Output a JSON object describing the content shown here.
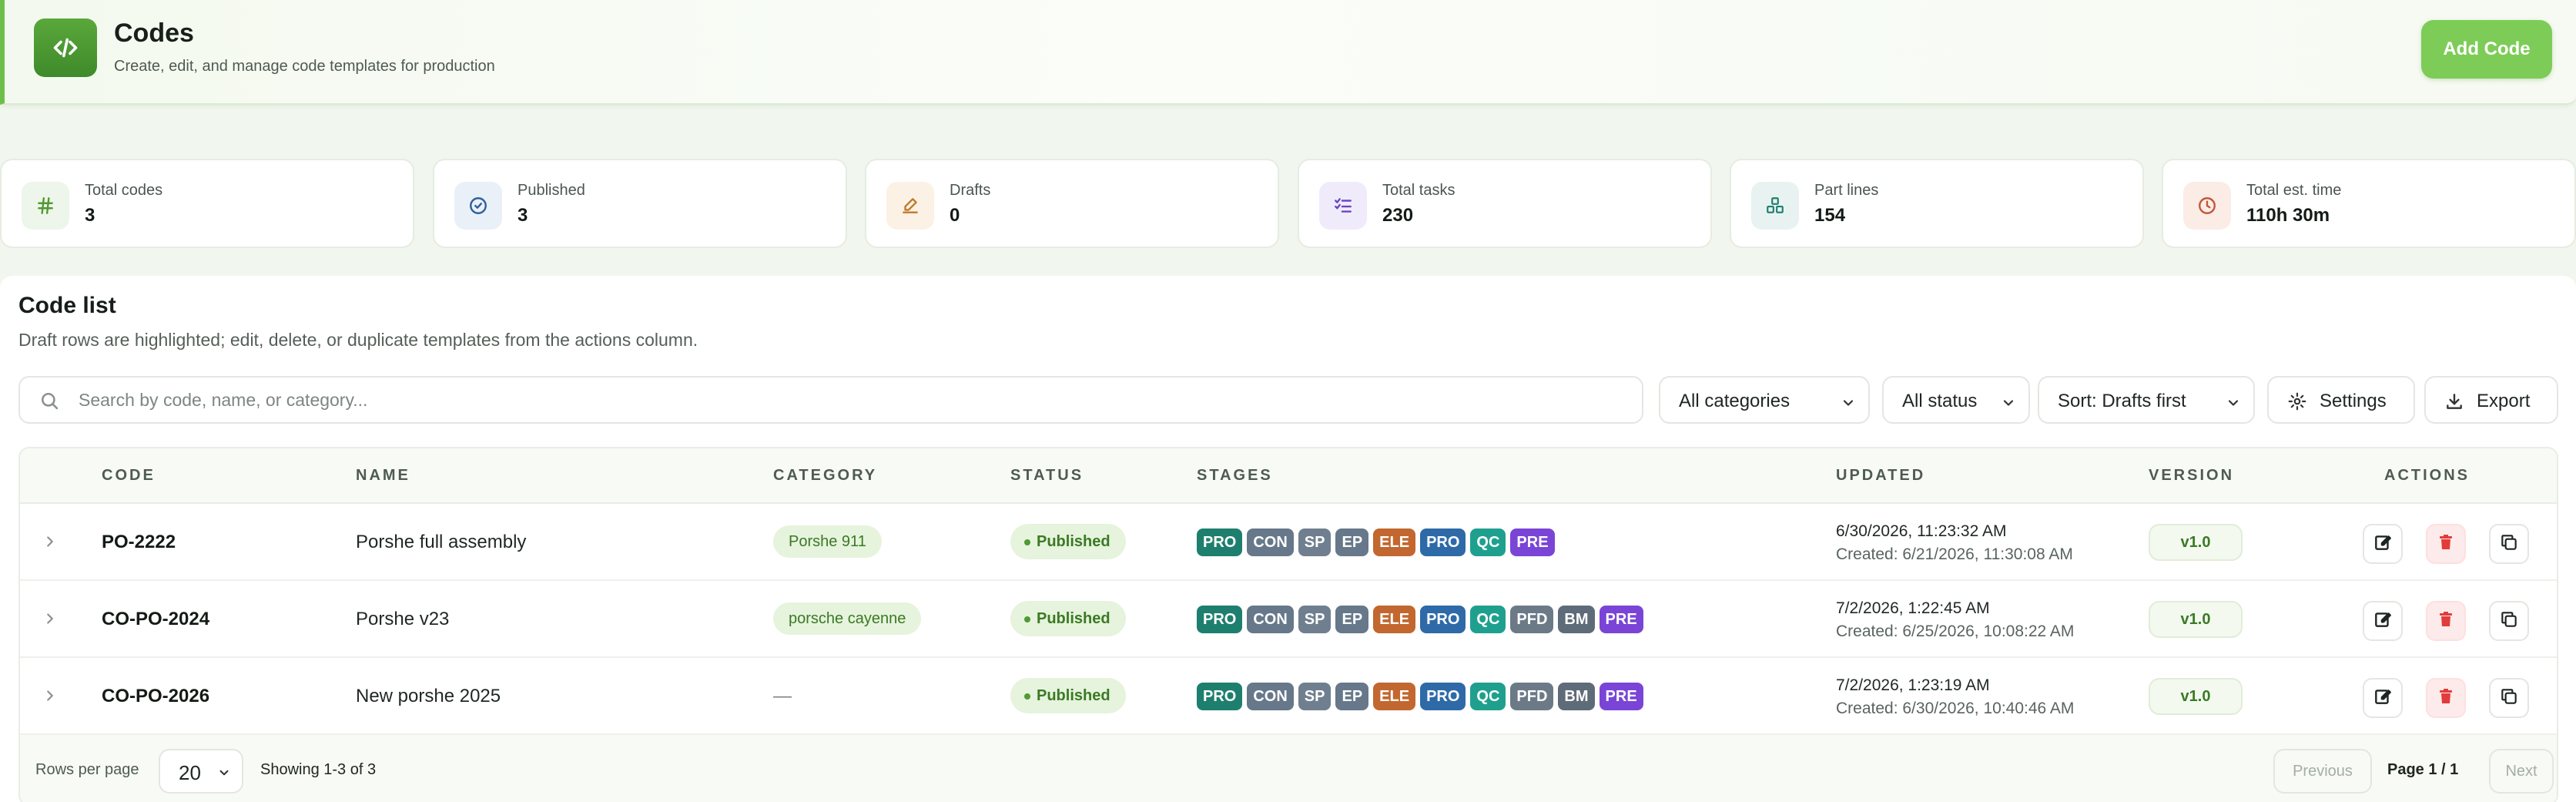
{
  "header": {
    "title": "Codes",
    "subtitle": "Create, edit, and manage code templates for production",
    "add_button": "Add Code"
  },
  "stats": [
    {
      "label": "Total codes",
      "value": "3",
      "icon": "hash-icon"
    },
    {
      "label": "Published",
      "value": "3",
      "icon": "check-circle-icon"
    },
    {
      "label": "Drafts",
      "value": "0",
      "icon": "pencil-icon"
    },
    {
      "label": "Total tasks",
      "value": "230",
      "icon": "checklist-icon"
    },
    {
      "label": "Part lines",
      "value": "154",
      "icon": "boxes-icon"
    },
    {
      "label": "Total est. time",
      "value": "110h 30m",
      "icon": "clock-icon"
    }
  ],
  "list": {
    "title": "Code list",
    "subtitle": "Draft rows are highlighted; edit, delete, or duplicate templates from the actions column.",
    "search_placeholder": "Search by code, name, or category...",
    "category_filter": "All categories",
    "status_filter": "All status",
    "sort": "Sort: Drafts first",
    "settings_button": "Settings",
    "export_button": "Export"
  },
  "table": {
    "headers": [
      "CODE",
      "NAME",
      "CATEGORY",
      "STATUS",
      "STAGES",
      "UPDATED",
      "VERSION",
      "ACTIONS"
    ],
    "rows": [
      {
        "code": "PO-2222",
        "name": "Porshe full assembly",
        "category": "Porshe 911",
        "status": "Published",
        "stages": [
          "PRO",
          "CON",
          "SP",
          "EP",
          "ELE",
          "PRO",
          "QC",
          "PRE"
        ],
        "updated": "6/30/2026, 11:23:32 AM",
        "created": "Created: 6/21/2026, 11:30:08 AM",
        "version": "v1.0"
      },
      {
        "code": "CO-PO-2024",
        "name": "Porshe v23",
        "category": "porsche cayenne",
        "status": "Published",
        "stages": [
          "PRO",
          "CON",
          "SP",
          "EP",
          "ELE",
          "PRO",
          "QC",
          "PFD",
          "BM",
          "PRE"
        ],
        "updated": "7/2/2026, 1:22:45 AM",
        "created": "Created: 6/25/2026, 10:08:22 AM",
        "version": "v1.0"
      },
      {
        "code": "CO-PO-2026",
        "name": "New porshe 2025",
        "category": "—",
        "status": "Published",
        "stages": [
          "PRO",
          "CON",
          "SP",
          "EP",
          "ELE",
          "PRO",
          "QC",
          "PFD",
          "BM",
          "PRE"
        ],
        "updated": "7/2/2026, 1:23:19 AM",
        "created": "Created: 6/30/2026, 10:40:46 AM",
        "version": "v1.0"
      }
    ]
  },
  "stage_colors": {
    "PRO": "#1e7f6e",
    "CON": "#66788a",
    "SP": "#6f7f8f",
    "EP": "#66788a",
    "ELE": "#c2672f",
    "PRO2": "#2e6aa8",
    "QC": "#1fa08f",
    "PFD": "#6c7a88",
    "BM": "#5e6b78",
    "PRE": "#7a45d6"
  },
  "footer": {
    "rows_per_page_label": "Rows per page",
    "rows_per_page": "20",
    "showing": "Showing 1-3 of 3",
    "previous": "Previous",
    "page": "Page 1 / 1",
    "next": "Next"
  },
  "colors": {
    "accent": "#7dcc57",
    "brand_dark": "#3f8a2a",
    "published_bg": "#e6f3dd",
    "delete_red": "#e23b3b"
  }
}
